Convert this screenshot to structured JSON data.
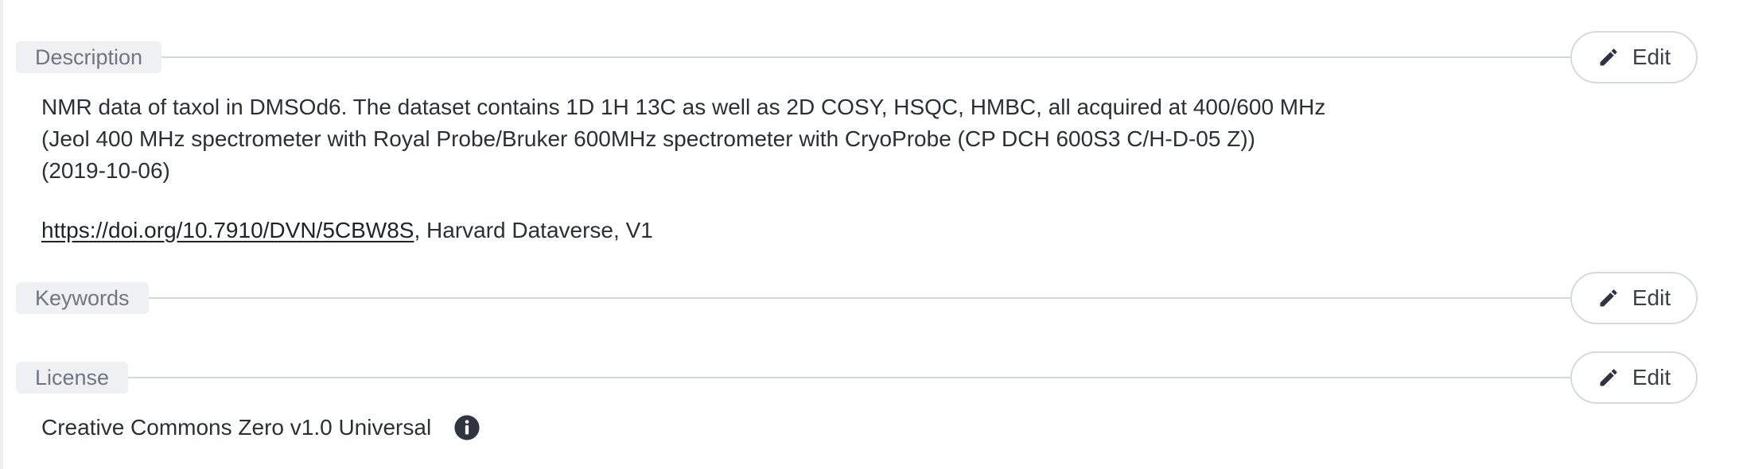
{
  "sections": {
    "description": {
      "title": "Description",
      "edit_label": "Edit",
      "lines": [
        "NMR data of taxol in DMSOd6. The dataset contains 1D 1H 13C as well as 2D COSY, HSQC, HMBC, all acquired at 400/600 MHz",
        "(Jeol 400 MHz spectrometer with Royal Probe/Bruker 600MHz spectrometer with CryoProbe (CP DCH 600S3 C/H-D-05 Z))",
        "(2019-10-06)"
      ],
      "citation": {
        "link_text": "https://doi.org/10.7910/DVN/5CBW8S",
        "suffix": ", Harvard Dataverse, V1"
      }
    },
    "keywords": {
      "title": "Keywords",
      "edit_label": "Edit"
    },
    "license": {
      "title": "License",
      "edit_label": "Edit",
      "value": "Creative Commons Zero v1.0 Universal"
    }
  },
  "icons": {
    "edit": "pencil-icon",
    "license_info": "info-icon"
  },
  "colors": {
    "text": "#2b2f38",
    "pill_bg": "#eef0f3",
    "pill_text": "#6f7681",
    "rule": "#d4d7dc",
    "icon": "#2f3440"
  }
}
